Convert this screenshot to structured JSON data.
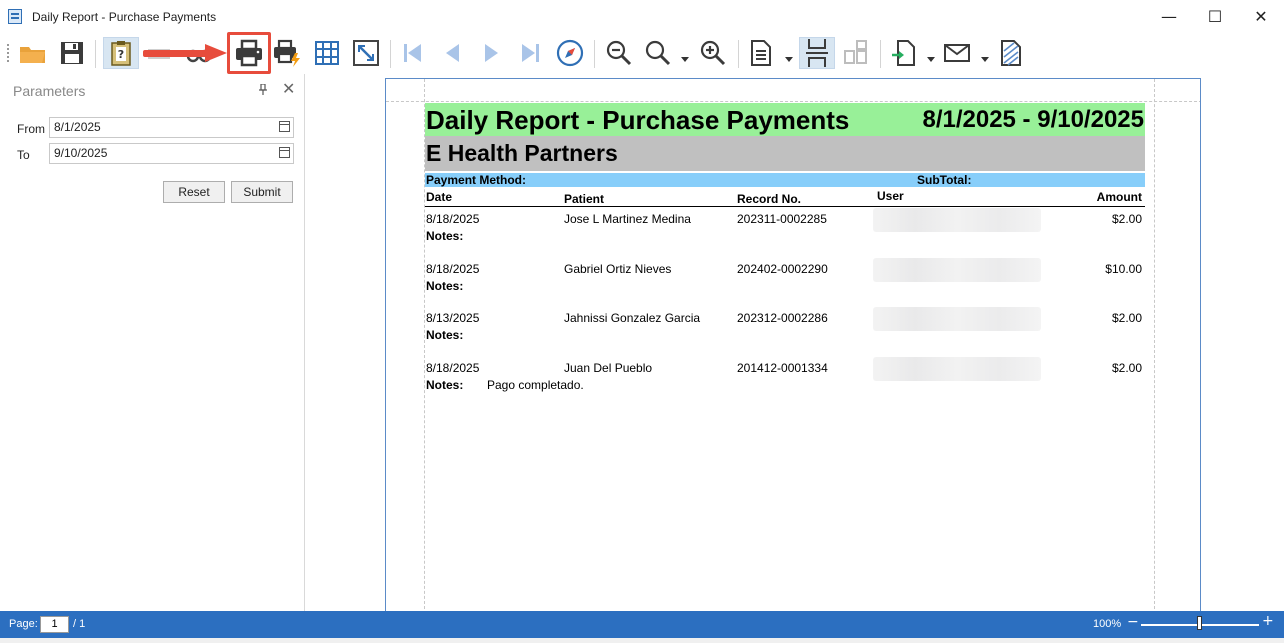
{
  "window": {
    "title": "Daily Report - Purchase Payments",
    "minimize_glyph": "—",
    "maximize_glyph": "☐",
    "close_glyph": "✕"
  },
  "toolbar": {
    "icons": [
      "open-folder-icon",
      "save-icon",
      "document-map-icon",
      "hand-tool-icon",
      "search-binoculars-icon",
      "print-icon",
      "quick-print-icon",
      "page-setup-icon",
      "scale-icon",
      "first-page-icon",
      "previous-page-icon",
      "next-page-icon",
      "last-page-icon",
      "navigation-compass-icon",
      "zoom-out-icon",
      "zoom-icon",
      "zoom-in-icon",
      "view-multiple-pages-icon",
      "continuous-scroll-icon",
      "side-by-side-icon",
      "export-icon",
      "send-email-icon",
      "watermark-icon"
    ],
    "highlight_color": "#e74c3c"
  },
  "parameters": {
    "title": "Parameters",
    "pin_glyph": "📌",
    "close_glyph": "✕",
    "from_label": "From",
    "from_value": "8/1/2025",
    "to_label": "To",
    "to_value": "9/10/2025",
    "reset_label": "Reset",
    "submit_label": "Submit"
  },
  "report": {
    "title": "Daily Report - Purchase Payments",
    "date_range": "8/1/2025 - 9/10/2025",
    "company": "E Health Partners",
    "payment_method_label": "Payment Method:",
    "subtotal_label": "SubTotal:",
    "columns": {
      "date": "Date",
      "patient": "Patient",
      "record": "Record No.",
      "user": "User",
      "amount": "Amount"
    },
    "notes_label": "Notes:",
    "rows": [
      {
        "date": "8/18/2025",
        "patient": "Jose L Martinez Medina",
        "record": "202311-0002285",
        "amount": "$2.00",
        "notes": ""
      },
      {
        "date": "8/18/2025",
        "patient": "Gabriel Ortiz Nieves",
        "record": "202402-0002290",
        "amount": "$10.00",
        "notes": ""
      },
      {
        "date": "8/13/2025",
        "patient": "Jahnissi Gonzalez Garcia",
        "record": "202312-0002286",
        "amount": "$2.00",
        "notes": ""
      },
      {
        "date": "8/18/2025",
        "patient": "Juan Del Pueblo",
        "record": "201412-0001334",
        "amount": "$2.00",
        "notes": "Pago completado."
      }
    ],
    "colors": {
      "title_bg": "#98f098",
      "company_bg": "#c0c0c0",
      "method_bg": "#87cefa"
    }
  },
  "statusbar": {
    "page_label": "Page:",
    "page_value": "1",
    "page_total": "/ 1",
    "zoom": "100%",
    "zoom_minus": "−",
    "zoom_plus": "+",
    "bg_color": "#2c6fc0"
  }
}
